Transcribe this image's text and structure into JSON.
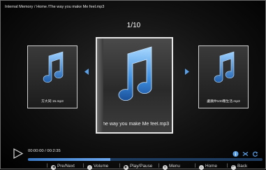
{
  "breadcrumb": "Internal Memory / Home /The way you make Me feel.mp3",
  "counter": "1/10",
  "albums": {
    "left": {
      "name": "方大同 15.mp3"
    },
    "center": {
      "name": "The way you make Me feel.mp3"
    },
    "right": {
      "name": "盧廣仲100種生活.mp3"
    }
  },
  "player": {
    "time": "00:00:00 / 00:2:35",
    "progress_fraction": 0.35
  },
  "hints": [
    {
      "icon": "pre-next-icon",
      "label": "Pre/Next"
    },
    {
      "icon": "volume-icon",
      "label": "Volume"
    },
    {
      "icon": "play-pause-icon",
      "label": "Play/Pause"
    },
    {
      "icon": "menu-icon",
      "label": "Menu"
    },
    {
      "icon": "home-icon",
      "label": "Home"
    },
    {
      "icon": "back-icon",
      "label": "Back"
    }
  ],
  "colors": {
    "accent": "#5aa0e8",
    "note": "#3f8fd8"
  }
}
